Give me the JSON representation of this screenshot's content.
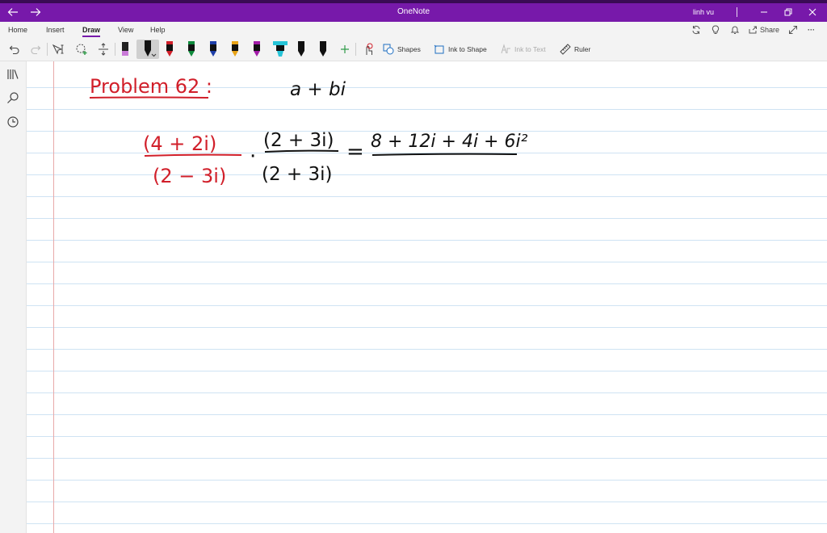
{
  "titlebar": {
    "app_title": "OneNote",
    "user_name": "linh vu",
    "back_icon": "arrow-left-icon",
    "forward_icon": "arrow-right-icon",
    "minimize_icon": "minimize-icon",
    "restore_icon": "restore-icon",
    "close_icon": "close-icon"
  },
  "ribbon": {
    "tabs": [
      {
        "label": "Home"
      },
      {
        "label": "Insert"
      },
      {
        "label": "Draw",
        "active": true
      },
      {
        "label": "View"
      },
      {
        "label": "Help"
      }
    ],
    "share_label": "Share",
    "more_label": "···"
  },
  "toolbar": {
    "shapes_label": "Shapes",
    "ink_to_shape_label": "Ink to Shape",
    "ink_to_text_label": "Ink to Text",
    "ruler_label": "Ruler",
    "pen_colors": [
      "#111111",
      "#d11f2a",
      "#0f8a3c",
      "#1f3fa8",
      "#e8a317",
      "#a21ca8",
      "#27c4d8",
      "#111111",
      "#111111"
    ]
  },
  "note": {
    "heading": "Problem 62 :",
    "subheading": "a + bi",
    "expr_num1": "(4 + 2i)",
    "expr_den1": "(2 − 3i)",
    "expr_dot": "·",
    "expr_num2": "(2 + 3i)",
    "expr_den2": "(2 + 3i)",
    "expr_equals": "=",
    "expr_result": "8 + 12i + 4i + 6i²",
    "ink_color_red": "#d11f2a",
    "ink_color_black": "#111111"
  },
  "colors": {
    "accent": "#7719aa",
    "ribbon_bg": "#f3f3f3",
    "rule_line": "#cfe3f3",
    "margin_line": "#e8a9a9"
  }
}
